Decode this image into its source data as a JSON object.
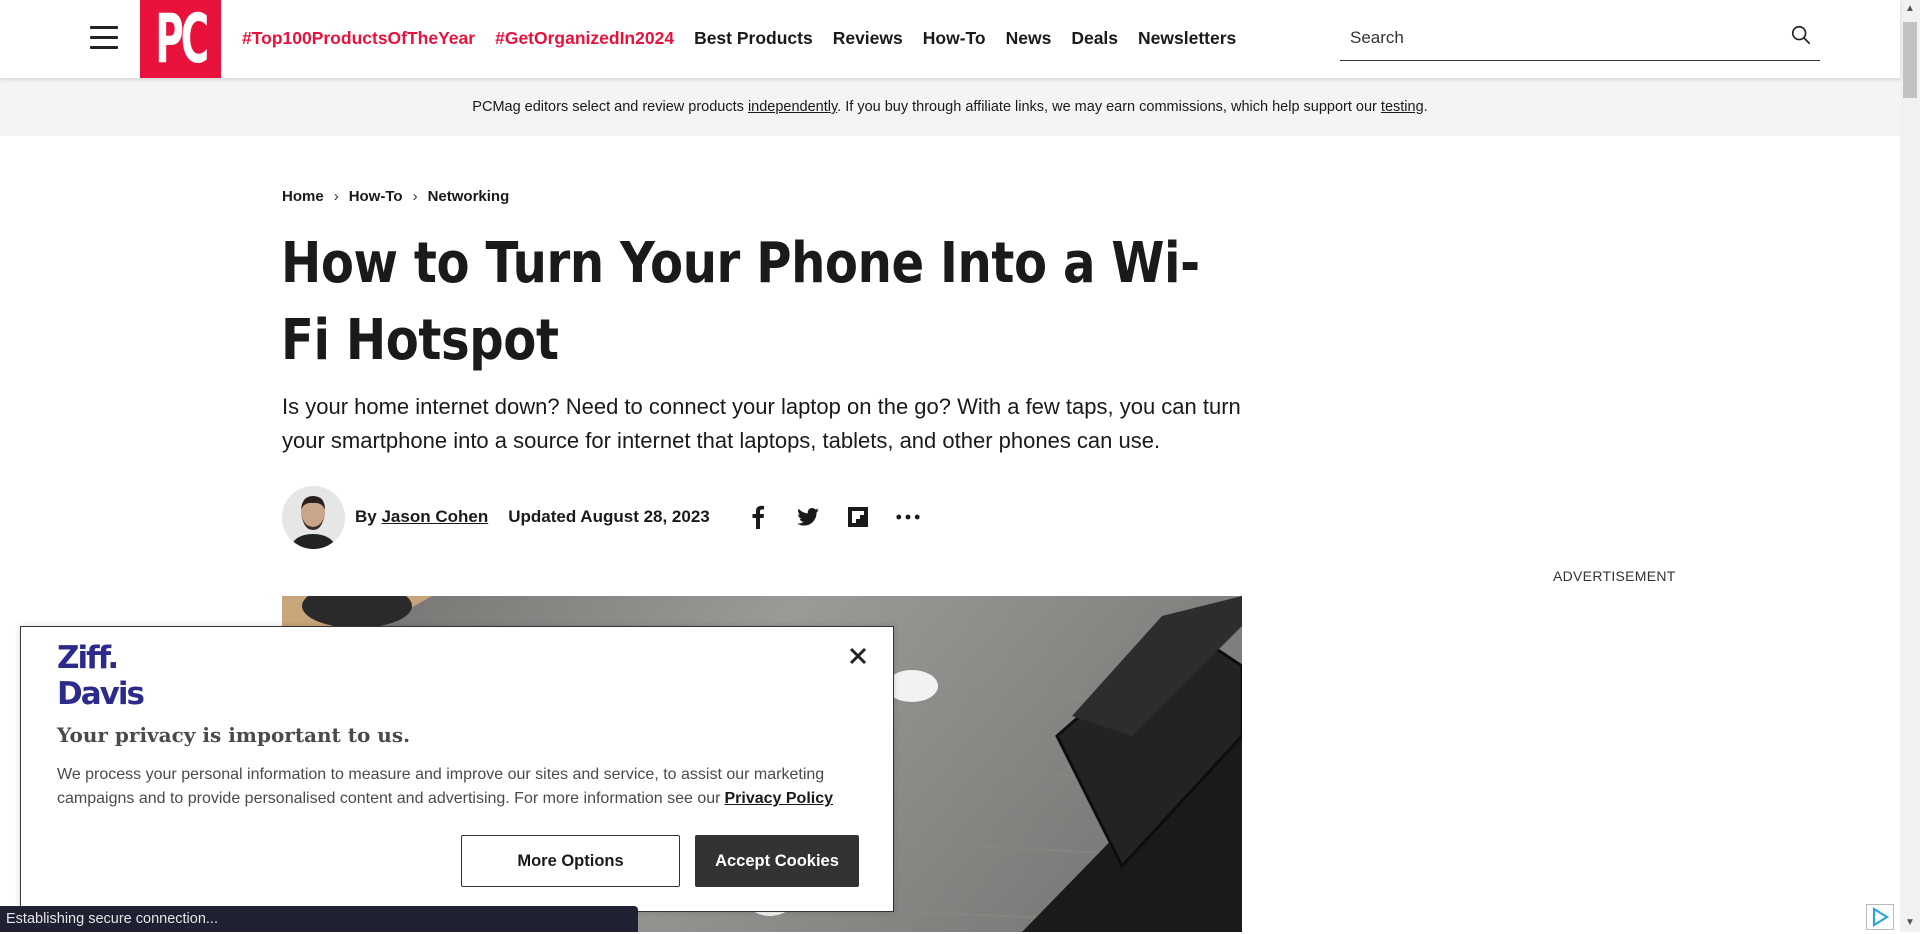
{
  "header": {
    "logo_text": "PC",
    "nav": [
      {
        "label": "#Top100ProductsOfTheYear",
        "hashtag": true
      },
      {
        "label": "#GetOrganizedIn2024",
        "hashtag": true
      },
      {
        "label": "Best Products",
        "hashtag": false
      },
      {
        "label": "Reviews",
        "hashtag": false
      },
      {
        "label": "How-To",
        "hashtag": false
      },
      {
        "label": "News",
        "hashtag": false
      },
      {
        "label": "Deals",
        "hashtag": false
      },
      {
        "label": "Newsletters",
        "hashtag": false
      }
    ],
    "search_placeholder": "Search"
  },
  "disclaimer": {
    "pre": "PCMag editors select and review products ",
    "link1": "independently",
    "mid": ". If you buy through affiliate links, we may earn commissions, which help support our ",
    "link2": "testing",
    "post": "."
  },
  "breadcrumb": [
    "Home",
    "How-To",
    "Networking"
  ],
  "article": {
    "title": "How to Turn Your Phone Into a Wi-Fi Hotspot",
    "dek": "Is your home internet down? Need to connect your laptop on the go? With a few taps, you can turn your smartphone into a source for internet that laptops, tablets, and other phones can use.",
    "by_prefix": "By",
    "author": "Jason Cohen",
    "updated": "Updated August 28, 2023"
  },
  "share_icons": [
    "facebook-icon",
    "twitter-icon",
    "flipboard-icon",
    "more-icon"
  ],
  "advertisement_label": "ADVERTISEMENT",
  "cookie_modal": {
    "logo_line1": "Ziff.",
    "logo_line2": "Davis",
    "heading": "Your privacy is important to us.",
    "body": "We process your personal information to measure and improve our sites and service, to assist our marketing campaigns and to provide personalised content and advertising. For more information see our",
    "policy_link": "Privacy Policy",
    "more_options": "More Options",
    "accept": "Accept Cookies"
  },
  "status_bar": "Establishing secure connection...",
  "colors": {
    "brand_red": "#e8123c",
    "ziff_davis_navy": "#2c2a8a",
    "accept_button": "#333333",
    "status_bar_bg": "#1f2032"
  }
}
